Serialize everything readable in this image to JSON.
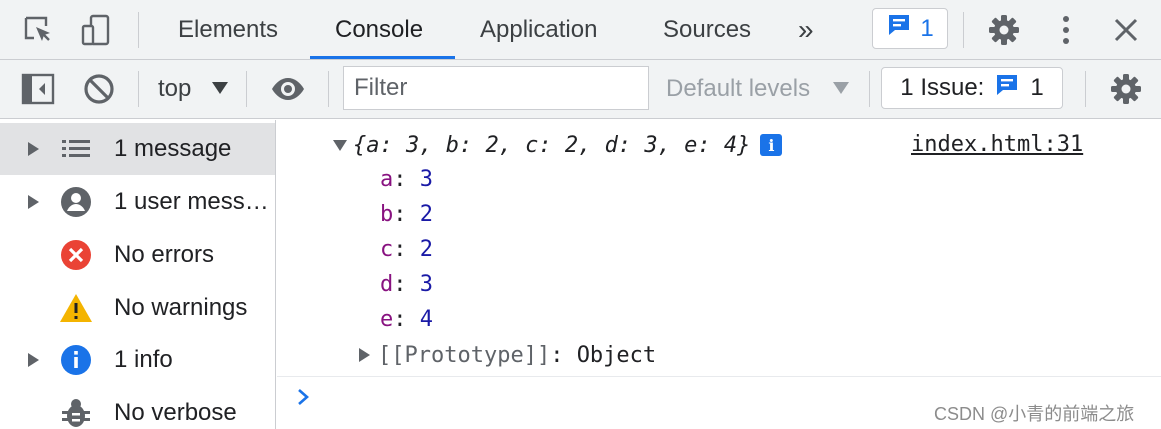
{
  "colors": {
    "accent": "#1a73e8",
    "toolbar_bg": "#f1f3f4",
    "selected_bg": "#e1e2e4",
    "prop_key": "#881280",
    "prop_number": "#1a1aa6",
    "error_red": "#ea4335",
    "warning_yellow": "#f4b400"
  },
  "tabbar": {
    "icons": [
      "inspect-element-icon",
      "device-toolbar-icon"
    ],
    "tabs": [
      {
        "label": "Elements",
        "active": false
      },
      {
        "label": "Console",
        "active": true
      },
      {
        "label": "Application",
        "active": false
      },
      {
        "label": "Sources",
        "active": false
      }
    ],
    "more_tabs": "»",
    "messages_count": "1",
    "right_icons": [
      "settings-gear-icon",
      "more-vertical-icon",
      "close-icon"
    ]
  },
  "toolbar": {
    "context": "top",
    "filter_placeholder": "Filter",
    "levels": "Default levels",
    "issues_label": "1 Issue:",
    "issues_count": "1"
  },
  "sidebar": {
    "items": [
      {
        "label": "1 message",
        "icon": "list-icon",
        "expandable": true,
        "selected": true
      },
      {
        "label": "1 user messages",
        "icon": "user-icon",
        "expandable": true,
        "selected": false
      },
      {
        "label": "No errors",
        "icon": "error-icon",
        "expandable": false,
        "selected": false
      },
      {
        "label": "No warnings",
        "icon": "warning-icon",
        "expandable": false,
        "selected": false
      },
      {
        "label": "1 info",
        "icon": "info-icon",
        "expandable": true,
        "selected": false
      },
      {
        "label": "No verbose",
        "icon": "bug-icon",
        "expandable": false,
        "selected": false
      }
    ]
  },
  "console": {
    "object_preview": "{a: 3, b: 2, c: 2, d: 3, e: 4}",
    "source": "index.html:31",
    "properties": [
      {
        "key": "a",
        "value": "3"
      },
      {
        "key": "b",
        "value": "2"
      },
      {
        "key": "c",
        "value": "2"
      },
      {
        "key": "d",
        "value": "3"
      },
      {
        "key": "e",
        "value": "4"
      }
    ],
    "prototype_key": "[[Prototype]]",
    "prototype_value": "Object",
    "prompt_symbol": "›"
  },
  "watermark": "CSDN @小青的前端之旅"
}
